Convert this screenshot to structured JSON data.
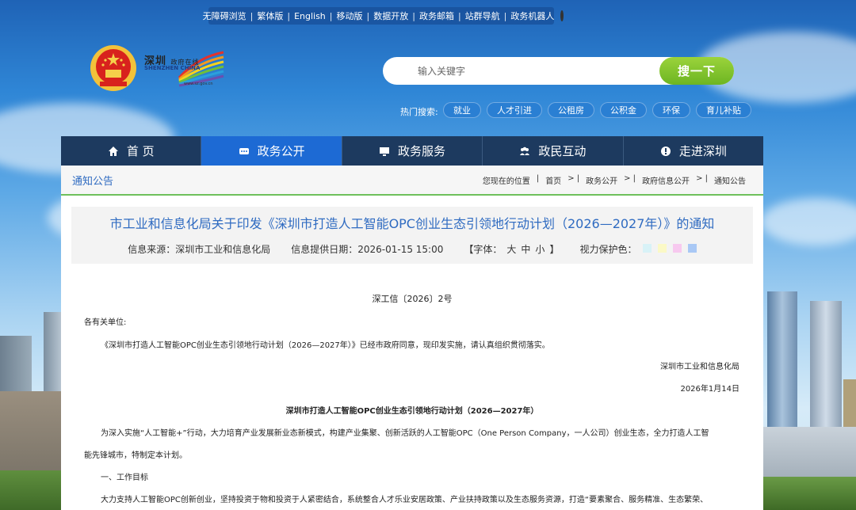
{
  "top_links": [
    "无障碍浏览",
    "繁体版",
    "English",
    "移动版",
    "数据开放",
    "政务邮箱",
    "站群导航",
    "政务机器人"
  ],
  "logo": {
    "cn": "深圳",
    "sub": "政府在线",
    "en": "SHENZHEN CHINA",
    "url": "www.sz.gov.cn"
  },
  "search": {
    "placeholder": "输入关键字",
    "button": "搜一下"
  },
  "hot_search": {
    "label": "热门搜索:",
    "tags": [
      "就业",
      "人才引进",
      "公租房",
      "公积金",
      "环保",
      "育儿补贴"
    ]
  },
  "nav": [
    {
      "label": "首 页",
      "icon": "home-icon",
      "active": false
    },
    {
      "label": "政务公开",
      "icon": "disclosure-icon",
      "active": true
    },
    {
      "label": "政务服务",
      "icon": "monitor-icon",
      "active": false
    },
    {
      "label": "政民互动",
      "icon": "people-icon",
      "active": false
    },
    {
      "label": "走进深圳",
      "icon": "info-circle-icon",
      "active": false
    }
  ],
  "section_title": "通知公告",
  "breadcrumb": {
    "label": "您现在的位置",
    "items": [
      "首页",
      "政务公开",
      "政府信息公开",
      "通知公告"
    ]
  },
  "article": {
    "title": "市工业和信息化局关于印发《深圳市打造人工智能OPC创业生态引领地行动计划（2026—2027年）》的通知",
    "source": "信息来源：深圳市工业和信息化局",
    "date": "信息提供日期：2026-01-15 15:00",
    "font_size_label": "【字体：",
    "font_sizes": [
      "大",
      "中",
      "小"
    ],
    "font_size_end": "】",
    "eye_protect_label": "视力保护色：",
    "eye_colors": [
      "#d8f2f7",
      "#fbf9c6",
      "#f7c9ef",
      "#a9c8f5"
    ],
    "doc_number": "深工信〔2026〕2号",
    "salutation": "各有关单位:",
    "intro": "《深圳市打造人工智能OPC创业生态引领地行动计划（2026—2027年）》已经市政府同意，现印发实施，请认真组织贯彻落实。",
    "signer": "深圳市工业和信息化局",
    "sign_date": "2026年1月14日",
    "plan_title": "深圳市打造人工智能OPC创业生态引领地行动计划（2026—2027年）",
    "para1_line1": "为深入实施“人工智能+”行动，大力培育产业发展新业态新模式，构建产业集聚、创新活跃的人工智能OPC（One Person Company，一人公司）创业生态，全力打造人工智",
    "para1_line2": "能先锋城市，特制定本计划。",
    "heading1": "一、工作目标",
    "para2_line1": "大力支持人工智能OPC创新创业，坚持投资于物和投资于人紧密结合，系统整合人才乐业安居政策、产业扶持政策以及生态服务资源，打造“要素聚合、服务精准、生态繁荣、"
  }
}
